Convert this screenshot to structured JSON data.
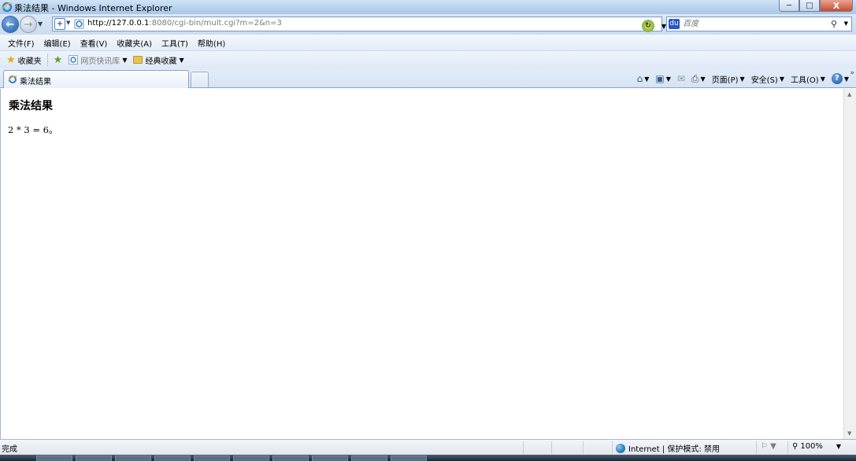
{
  "window": {
    "title": "乘法结果 - Windows Internet Explorer",
    "minimize": "─",
    "maximize": "□",
    "close": "X"
  },
  "address": {
    "url_host": "http://127.0.0.1",
    "url_rest": ":8080/cgi-bin/mult.cgi?m=2&n=3"
  },
  "search": {
    "placeholder": "百度",
    "magnifier": "⚲"
  },
  "menu": [
    "文件(F)",
    "编辑(E)",
    "查看(V)",
    "收藏夹(A)",
    "工具(T)",
    "帮助(H)"
  ],
  "favorites": {
    "favorites_label": "收藏夹",
    "quick_label": "网页快讯库",
    "classic_label": "经典收藏"
  },
  "tab": {
    "label": "乘法结果"
  },
  "commands": {
    "page": "页面(P)",
    "safety": "安全(S)",
    "tools": "工具(O)",
    "help": "?"
  },
  "content": {
    "heading": "乘法结果",
    "result": "2 * 3 = 6。"
  },
  "status": {
    "text": "完成",
    "zone": "Internet | 保护模式: 禁用",
    "zoom": "100%"
  },
  "colors": {
    "accent": "#1f5aa8",
    "close_button": "#c84b2d"
  }
}
